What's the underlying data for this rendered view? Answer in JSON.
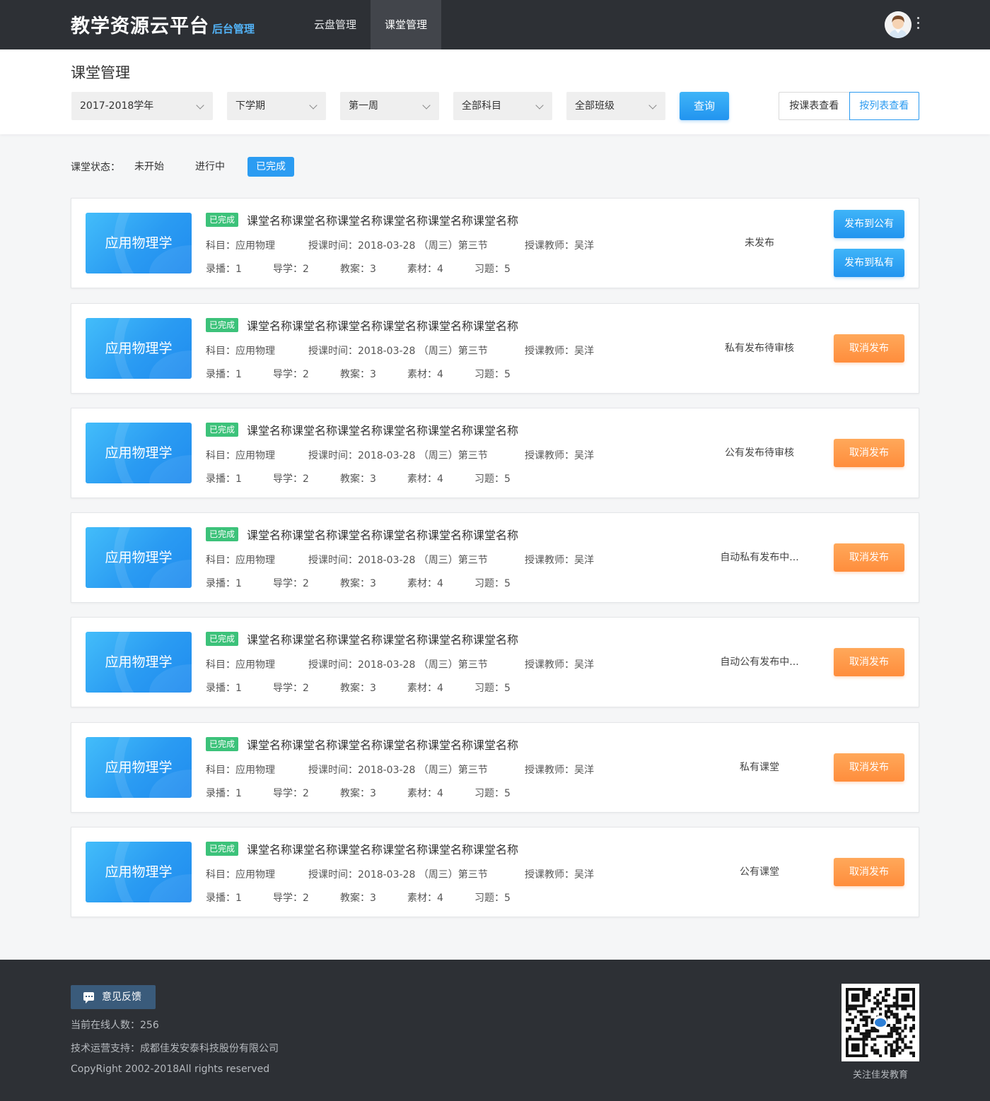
{
  "header": {
    "logo_main": "教学资源云平台",
    "logo_sub": "后台管理",
    "nav": [
      {
        "label": "云盘管理",
        "active": false
      },
      {
        "label": "课堂管理",
        "active": true
      }
    ],
    "avatar_icon": "user-avatar",
    "menu_icon": "more-vertical-icon"
  },
  "filters": {
    "page_title": "课堂管理",
    "year": "2017-2018学年",
    "term": "下学期",
    "week": "第一周",
    "subject": "全部科目",
    "class": "全部班级",
    "query_label": "查询",
    "view_by_schedule": "按课表查看",
    "view_by_list": "按列表查看"
  },
  "status_filter": {
    "label": "课堂状态：",
    "options": [
      "未开始",
      "进行中",
      "已完成"
    ],
    "active": "已完成"
  },
  "lessons": [
    {
      "thumb_text": "应用物理学",
      "badge": "已完成",
      "title": "课堂名称课堂名称课堂名称课堂名称课堂名称课堂名称",
      "subject": "科目：应用物理",
      "time": "授课时间：2018-03-28 （周三）第三节",
      "teacher": "授课教师：吴洋",
      "counts": {
        "record": "录播：1",
        "guide": "导学：2",
        "plan": "教案：3",
        "material": "素材：4",
        "exercise": "习题：5"
      },
      "publish_status": "未发布",
      "actions": [
        "发布到公有",
        "发布到私有"
      ]
    },
    {
      "thumb_text": "应用物理学",
      "badge": "已完成",
      "title": "课堂名称课堂名称课堂名称课堂名称课堂名称课堂名称",
      "subject": "科目：应用物理",
      "time": "授课时间：2018-03-28 （周三）第三节",
      "teacher": "授课教师：吴洋",
      "counts": {
        "record": "录播：1",
        "guide": "导学：2",
        "plan": "教案：3",
        "material": "素材：4",
        "exercise": "习题：5"
      },
      "publish_status": "私有发布待审核",
      "actions": [
        "取消发布"
      ]
    },
    {
      "thumb_text": "应用物理学",
      "badge": "已完成",
      "title": "课堂名称课堂名称课堂名称课堂名称课堂名称课堂名称",
      "subject": "科目：应用物理",
      "time": "授课时间：2018-03-28 （周三）第三节",
      "teacher": "授课教师：吴洋",
      "counts": {
        "record": "录播：1",
        "guide": "导学：2",
        "plan": "教案：3",
        "material": "素材：4",
        "exercise": "习题：5"
      },
      "publish_status": "公有发布待审核",
      "actions": [
        "取消发布"
      ]
    },
    {
      "thumb_text": "应用物理学",
      "badge": "已完成",
      "title": "课堂名称课堂名称课堂名称课堂名称课堂名称课堂名称",
      "subject": "科目：应用物理",
      "time": "授课时间：2018-03-28 （周三）第三节",
      "teacher": "授课教师：吴洋",
      "counts": {
        "record": "录播：1",
        "guide": "导学：2",
        "plan": "教案：3",
        "material": "素材：4",
        "exercise": "习题：5"
      },
      "publish_status": "自动私有发布中...",
      "actions": [
        "取消发布"
      ]
    },
    {
      "thumb_text": "应用物理学",
      "badge": "已完成",
      "title": "课堂名称课堂名称课堂名称课堂名称课堂名称课堂名称",
      "subject": "科目：应用物理",
      "time": "授课时间：2018-03-28 （周三）第三节",
      "teacher": "授课教师：吴洋",
      "counts": {
        "record": "录播：1",
        "guide": "导学：2",
        "plan": "教案：3",
        "material": "素材：4",
        "exercise": "习题：5"
      },
      "publish_status": "自动公有发布中...",
      "actions": [
        "取消发布"
      ]
    },
    {
      "thumb_text": "应用物理学",
      "badge": "已完成",
      "title": "课堂名称课堂名称课堂名称课堂名称课堂名称课堂名称",
      "subject": "科目：应用物理",
      "time": "授课时间：2018-03-28 （周三）第三节",
      "teacher": "授课教师：吴洋",
      "counts": {
        "record": "录播：1",
        "guide": "导学：2",
        "plan": "教案：3",
        "material": "素材：4",
        "exercise": "习题：5"
      },
      "publish_status": "私有课堂",
      "actions": [
        "取消发布"
      ]
    },
    {
      "thumb_text": "应用物理学",
      "badge": "已完成",
      "title": "课堂名称课堂名称课堂名称课堂名称课堂名称课堂名称",
      "subject": "科目：应用物理",
      "time": "授课时间：2018-03-28 （周三）第三节",
      "teacher": "授课教师：吴洋",
      "counts": {
        "record": "录播：1",
        "guide": "导学：2",
        "plan": "教案：3",
        "material": "素材：4",
        "exercise": "习题：5"
      },
      "publish_status": "公有课堂",
      "actions": [
        "取消发布"
      ]
    }
  ],
  "footer": {
    "feedback_label": "意见反馈",
    "online": "当前在线人数：256",
    "support": "技术运营支持：成都佳发安泰科技股份有限公司",
    "copyright": "CopyRight 2002-2018All rights reserved",
    "qr_caption": "关注佳发教育"
  },
  "colors": {
    "header_bg": "#2d3035",
    "accent_blue": "#2b9cf2",
    "action_orange": "#ff8d3c",
    "badge_green": "#3cc27a"
  }
}
